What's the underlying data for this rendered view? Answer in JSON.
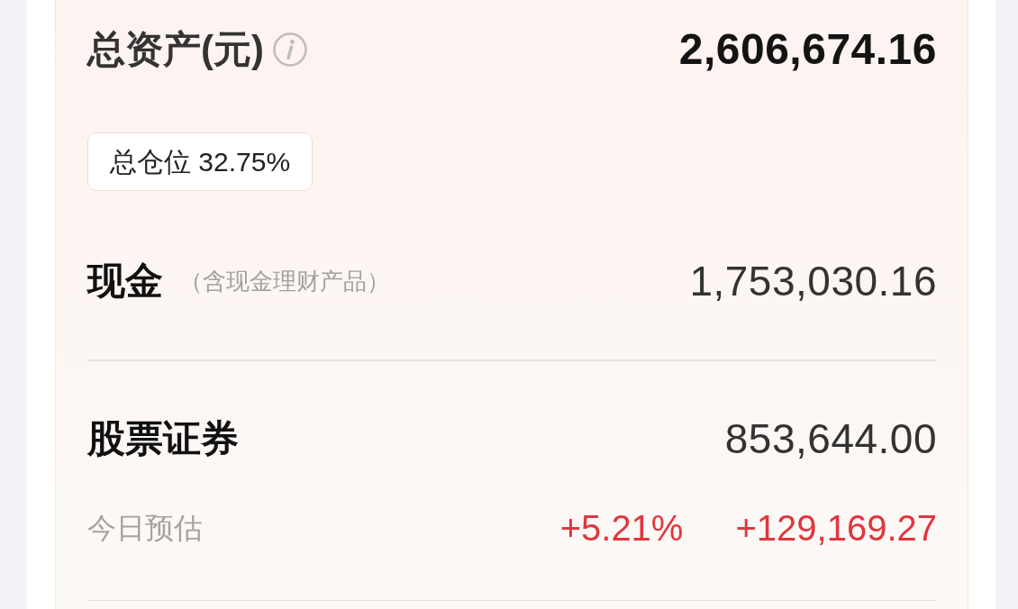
{
  "total_assets": {
    "label": "总资产(元)",
    "value": "2,606,674.16"
  },
  "position_badge": {
    "text": "总仓位 32.75%"
  },
  "rows": [
    {
      "label": "现金",
      "note": "（含现金理财产品）",
      "value": "1,753,030.16"
    },
    {
      "label": "股票证券",
      "value": "853,644.00",
      "estimate": {
        "label": "今日预估",
        "percent": "+5.21%",
        "amount": "+129,169.27",
        "gain": true
      }
    }
  ]
}
